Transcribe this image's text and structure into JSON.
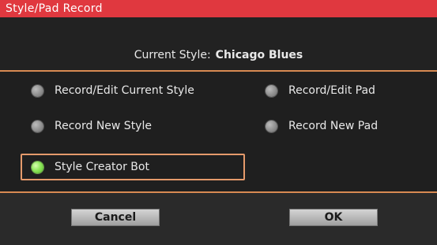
{
  "window": {
    "title": "Style/Pad Record"
  },
  "header": {
    "label": "Current Style:",
    "style_name": "Chicago Blues"
  },
  "options": [
    {
      "label": "Record/Edit Current Style",
      "selected": false
    },
    {
      "label": "Record/Edit Pad",
      "selected": false
    },
    {
      "label": "Record New Style",
      "selected": false
    },
    {
      "label": "Record New Pad",
      "selected": false
    },
    {
      "label": "Style Creator Bot",
      "selected": true
    }
  ],
  "buttons": {
    "cancel": "Cancel",
    "ok": "OK"
  },
  "colors": {
    "title_bar": "#e0383f",
    "divider": "#d88a52",
    "highlight_border": "#e59a6b",
    "selected_radio": "#8ee85a"
  }
}
